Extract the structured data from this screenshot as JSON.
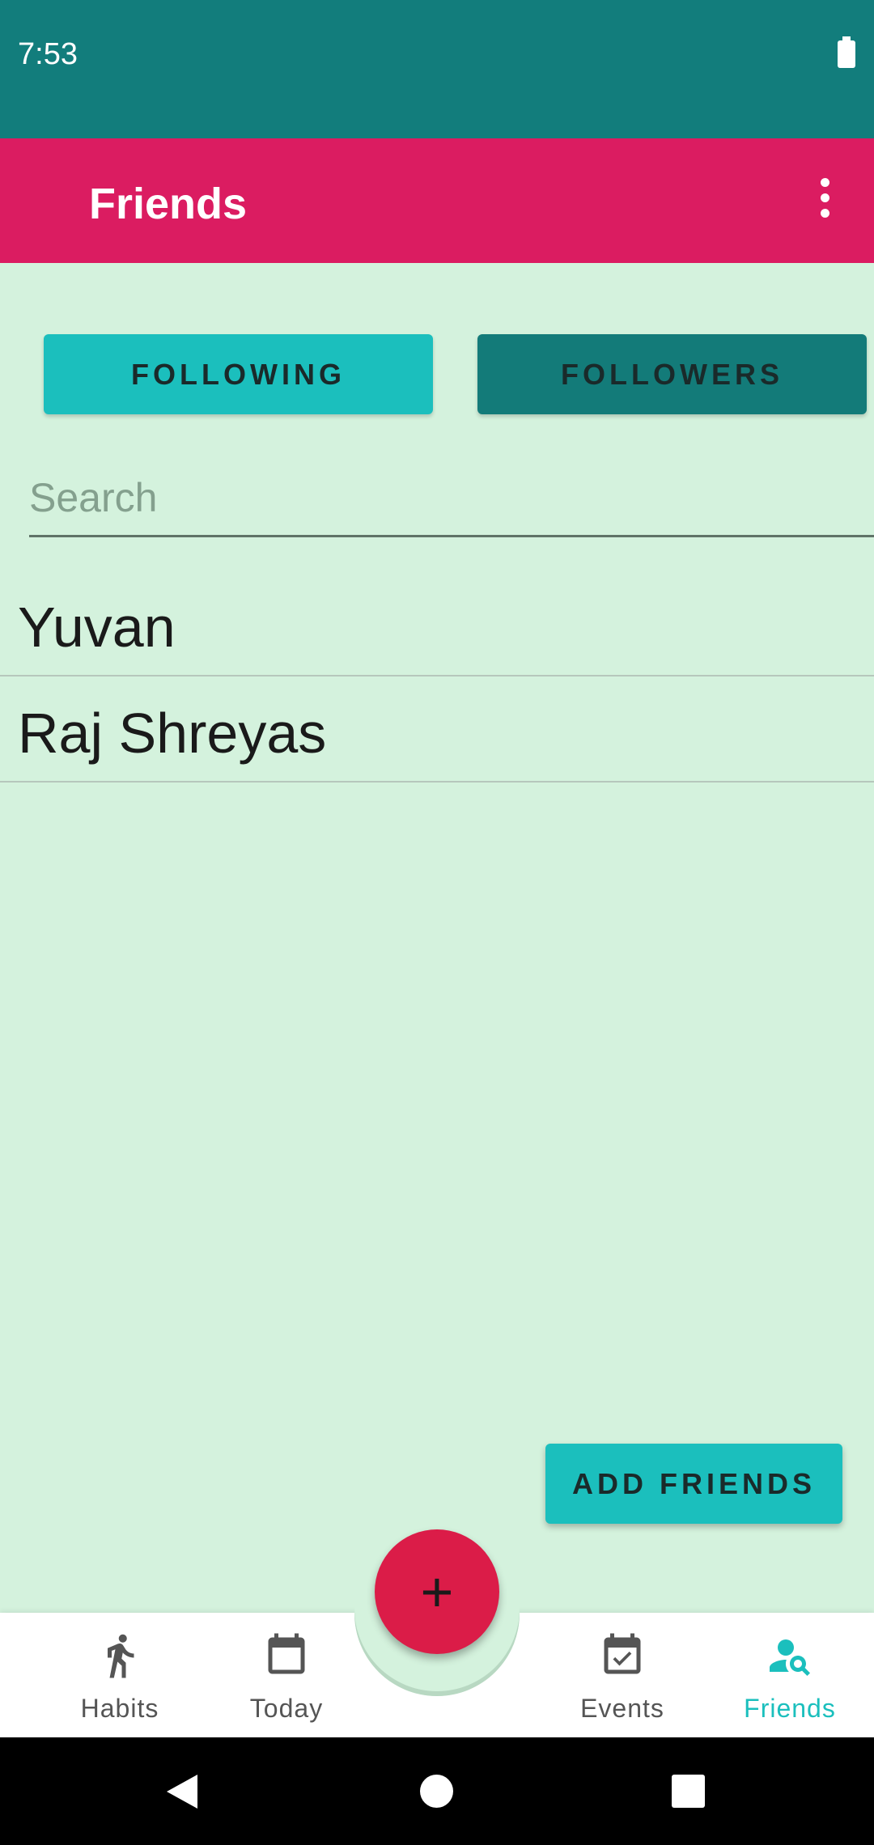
{
  "status_bar": {
    "time": "7:53"
  },
  "app_bar": {
    "title": "Friends",
    "overflow_icon": "more-vert-icon"
  },
  "toggle": {
    "following_label": "FOLLOWING",
    "followers_label": "FOLLOWERS"
  },
  "search": {
    "placeholder": "Search",
    "value": ""
  },
  "friends": [
    {
      "name": "Yuvan"
    },
    {
      "name": "Raj Shreyas"
    }
  ],
  "add_friends_label": "ADD FRIENDS",
  "fab": {
    "label": "+"
  },
  "bottom_nav": {
    "items": [
      {
        "label": "Habits",
        "icon": "running-person-icon",
        "active": false
      },
      {
        "label": "Today",
        "icon": "calendar-icon",
        "active": false
      },
      {
        "label": "Events",
        "icon": "calendar-check-icon",
        "active": false
      },
      {
        "label": "Friends",
        "icon": "person-search-icon",
        "active": true
      }
    ]
  },
  "colors": {
    "status_bar": "#127d7c",
    "app_bar": "#db1c61",
    "background": "#d4f2dd",
    "accent": "#1bbfbd",
    "dark_teal": "#137b79",
    "fab": "#db1c48"
  }
}
